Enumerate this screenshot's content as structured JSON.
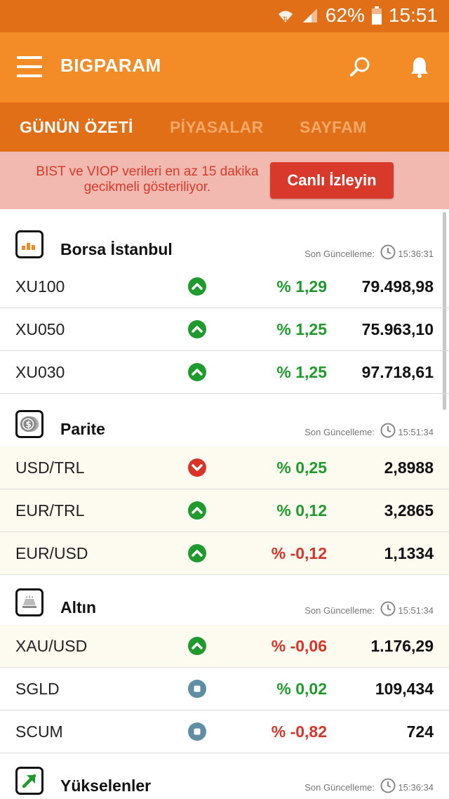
{
  "status_bar": {
    "battery": "62%",
    "time": "15:51"
  },
  "app_bar": {
    "title": "BIGPARAM"
  },
  "tabs": [
    {
      "label": "GÜNÜN ÖZETİ",
      "active": true
    },
    {
      "label": "PİYASALAR",
      "active": false
    },
    {
      "label": "SAYFAM",
      "active": false
    }
  ],
  "notice": {
    "text": "BIST ve VIOP verileri en az 15 dakika gecikmeli gösteriliyor.",
    "button": "Canlı İzleyin"
  },
  "colors": {
    "appbar": "#f38b26",
    "dark_orange": "#e06f17",
    "positive": "#1f9a2c",
    "negative": "#d9342a",
    "neutral": "#5f8ea3"
  },
  "sections": [
    {
      "title": "Borsa İstanbul",
      "icon": "bar-chart-icon",
      "update_label": "Son Güncelleme:",
      "update_time": "15:36:31",
      "rows": [
        {
          "name": "XU100",
          "direction": "up",
          "pct": "% 1,29",
          "value": "79.498,98"
        },
        {
          "name": "XU050",
          "direction": "up",
          "pct": "% 1,25",
          "value": "75.963,10"
        },
        {
          "name": "XU030",
          "direction": "up",
          "pct": "% 1,25",
          "value": "97.718,61"
        }
      ]
    },
    {
      "title": "Parite",
      "icon": "coin-icon",
      "update_label": "Son Güncelleme:",
      "update_time": "15:51:34",
      "rows": [
        {
          "name": "USD/TRL",
          "direction": "down",
          "pct": "% 0,25",
          "value": "2,8988"
        },
        {
          "name": "EUR/TRL",
          "direction": "up",
          "pct": "% 0,12",
          "value": "3,2865"
        },
        {
          "name": "EUR/USD",
          "direction": "up",
          "pct": "% -0,12",
          "value": "1,1334"
        }
      ]
    },
    {
      "title": "Altın",
      "icon": "gold-bar-icon",
      "update_label": "Son Güncelleme:",
      "update_time": "15:51:34",
      "rows": [
        {
          "name": "XAU/USD",
          "direction": "up",
          "pct": "% -0,06",
          "value": "1.176,29"
        },
        {
          "name": "SGLD",
          "direction": "flat",
          "pct": "% 0,02",
          "value": "109,434"
        },
        {
          "name": "SCUM",
          "direction": "flat",
          "pct": "% -0,82",
          "value": "724"
        }
      ]
    },
    {
      "title": "Yükselenler",
      "icon": "trend-up-icon",
      "update_label": "Son Güncelleme:",
      "update_time": "15:36:34",
      "rows": []
    }
  ]
}
